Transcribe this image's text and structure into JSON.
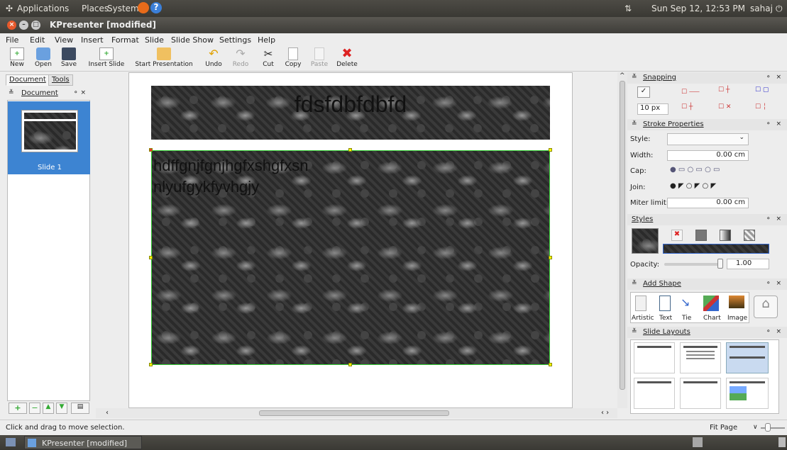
{
  "top_panel": {
    "applications": "Applications",
    "places": "Places",
    "system": "System",
    "clock": "Sun Sep 12, 12:53 PM",
    "user": "sahaj"
  },
  "window": {
    "title": "KPresenter [modified]"
  },
  "menu": [
    "File",
    "Edit",
    "View",
    "Insert",
    "Format",
    "Slide",
    "Slide Show",
    "Settings",
    "Help"
  ],
  "toolbar": {
    "new": "New",
    "open": "Open",
    "save": "Save",
    "insert_slide": "Insert Slide",
    "start_presentation": "Start Presentation",
    "undo": "Undo",
    "redo": "Redo",
    "cut": "Cut",
    "copy": "Copy",
    "paste": "Paste",
    "delete": "Delete"
  },
  "left_panel": {
    "tab_document": "Document",
    "tab_tools": "Tools",
    "dock_title": "Document",
    "slide_label": "Slide 1"
  },
  "slide": {
    "title_text": "fdsfdbfdbfd",
    "body_line1": "hdffgnjfgnjhgfxshgfxsn",
    "body_line2": "nlyufgykfyvhgjy"
  },
  "snapping": {
    "title": "Snapping",
    "value": "10 px"
  },
  "stroke": {
    "title": "Stroke Properties",
    "style_label": "Style:",
    "width_label": "Width:",
    "width_value": "0.00 cm",
    "cap_label": "Cap:",
    "join_label": "Join:",
    "miter_label": "Miter limit:",
    "miter_value": "0.00 cm"
  },
  "styles": {
    "title": "Styles",
    "opacity_label": "Opacity:",
    "opacity_value": "1.00"
  },
  "add_shape": {
    "title": "Add Shape",
    "items": [
      "Artistic",
      "Text",
      "Tie",
      "Chart",
      "Image"
    ]
  },
  "slide_layouts": {
    "title": "Slide Layouts"
  },
  "status": {
    "message": "Click and drag to move selection.",
    "zoom": "Fit Page"
  },
  "taskbar": {
    "item": "KPresenter [modified]"
  }
}
